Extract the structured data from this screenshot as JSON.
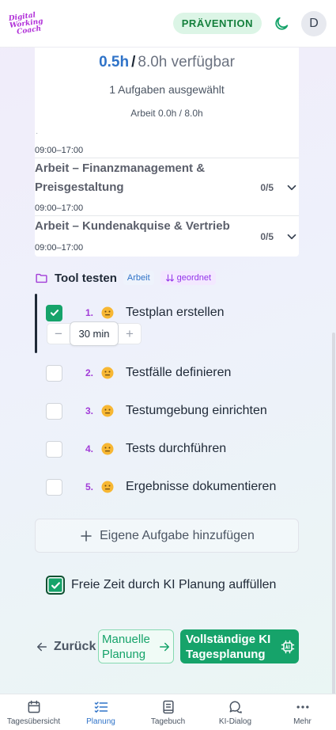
{
  "header": {
    "logo_lines": [
      "Digital",
      "Working",
      "Coach"
    ],
    "mode_badge": "PRÄVENTION",
    "avatar_initial": "D"
  },
  "summary": {
    "used_hours": "0.5h",
    "separator": "/",
    "available": "8.0h verfügbar",
    "selected_text": "1 Aufgaben ausgewählt",
    "work_ratio": "Arbeit 0.0h / 8.0h",
    "blocks": [
      {
        "time": "09:00–17:00"
      },
      {
        "title": "Arbeit – Finanzmanagement & Preisgestaltung",
        "count": "0/5",
        "time": "09:00–17:00"
      },
      {
        "title": "Arbeit – Kundenakquise & Vertrieb",
        "count": "0/5",
        "time": "09:00–17:00"
      }
    ]
  },
  "project": {
    "name": "Tool testen",
    "category_tag": "Arbeit",
    "sort_tag": "geordnet"
  },
  "tasks": [
    {
      "number": "1.",
      "label": "Testplan erstellen",
      "checked": true,
      "duration": "30 min"
    },
    {
      "number": "2.",
      "label": "Testfälle definieren",
      "checked": false
    },
    {
      "number": "3.",
      "label": "Testumgebung einrichten",
      "checked": false
    },
    {
      "number": "4.",
      "label": "Tests durchführen",
      "checked": false
    },
    {
      "number": "5.",
      "label": "Ergebnisse dokumentieren",
      "checked": false
    }
  ],
  "add_own_task": "Eigene Aufgabe hinzufügen",
  "fill_free_time": {
    "label": "Freie Zeit durch KI Planung auffüllen",
    "checked": true
  },
  "actions": {
    "back": "Zurück",
    "manual_line1": "Manuelle",
    "manual_line2": "Planung",
    "ki_line1": "Vollständige KI",
    "ki_line2": "Tagesplanung"
  },
  "nav": [
    {
      "label": "Tagesübersicht",
      "icon": "calendar-icon",
      "active": false
    },
    {
      "label": "Planung",
      "icon": "checklist-icon",
      "active": true
    },
    {
      "label": "Tagebuch",
      "icon": "book-icon",
      "active": false
    },
    {
      "label": "KI-Dialog",
      "icon": "chat-icon",
      "active": false
    },
    {
      "label": "Mehr",
      "icon": "more-icon",
      "active": false
    }
  ],
  "colors": {
    "accent_green": "#16a36a",
    "accent_blue": "#2f73c8",
    "accent_purple": "#a23cd8"
  }
}
